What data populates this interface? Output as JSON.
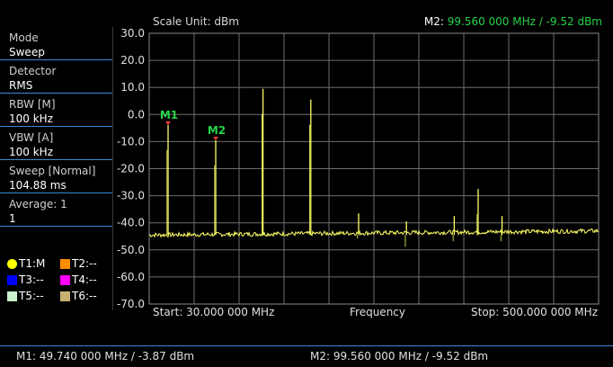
{
  "header": {
    "scale_unit": "Scale Unit: dBm",
    "marker_label": "M2:",
    "marker_value": "99.560 000 MHz / -9.52 dBm"
  },
  "params": [
    {
      "label": "Mode",
      "value": "Sweep"
    },
    {
      "label": "Detector",
      "value": "RMS"
    },
    {
      "label": "RBW [M]",
      "value": "100 kHz"
    },
    {
      "label": "VBW [A]",
      "value": "100 kHz"
    },
    {
      "label": "Sweep [Normal]",
      "value": "104.88 ms"
    },
    {
      "label": "Average: 1",
      "value": "1"
    }
  ],
  "traces": [
    {
      "label": "T1:M",
      "color": "#ffff00",
      "shape": "circle"
    },
    {
      "label": "T2:--",
      "color": "#ff8c00",
      "shape": "square"
    },
    {
      "label": "T3:--",
      "color": "#0000ff",
      "shape": "square"
    },
    {
      "label": "T4:--",
      "color": "#ff00ff",
      "shape": "square"
    },
    {
      "label": "T5:--",
      "color": "#ccf2cc",
      "shape": "square"
    },
    {
      "label": "T6:--",
      "color": "#c8b070",
      "shape": "square"
    }
  ],
  "axis": {
    "y_ticks": [
      "30.0",
      "20.0",
      "10.0",
      "0.0",
      "-10.0",
      "-20.0",
      "-30.0",
      "-40.0",
      "-50.0",
      "-60.0",
      "-70.0"
    ],
    "start": "Start: 30.000 000 MHz",
    "center": "Frequency",
    "stop": "Stop: 500.000 000 MHz"
  },
  "markers": [
    {
      "label": "M1",
      "x": 49.74,
      "y": -3.87
    },
    {
      "label": "M2",
      "x": 99.56,
      "y": -9.52
    }
  ],
  "status": {
    "m1": "M1: 49.740 000 MHz / -3.87 dBm",
    "m2": "M2: 99.560 000 MHz / -9.52 dBm"
  },
  "chart_data": {
    "type": "line",
    "xlabel": "Frequency",
    "xlim": [
      30,
      500
    ],
    "ylim": [
      -70,
      30
    ],
    "noise_floor": -44.5,
    "peaks": [
      {
        "x": 49.74,
        "y": -3.87
      },
      {
        "x": 99.56,
        "y": -9.52
      },
      {
        "x": 149.0,
        "y": 9.5
      },
      {
        "x": 199.0,
        "y": 5.5
      },
      {
        "x": 249.0,
        "y": -36.5
      },
      {
        "x": 299.0,
        "y": -39.5
      },
      {
        "x": 349.0,
        "y": -37.5
      },
      {
        "x": 374.0,
        "y": -27.5
      },
      {
        "x": 399.0,
        "y": -37.5
      }
    ],
    "colors": {
      "trace": "#ffff66",
      "grid": "#6e6e6e",
      "marker": "#27d34a"
    }
  }
}
